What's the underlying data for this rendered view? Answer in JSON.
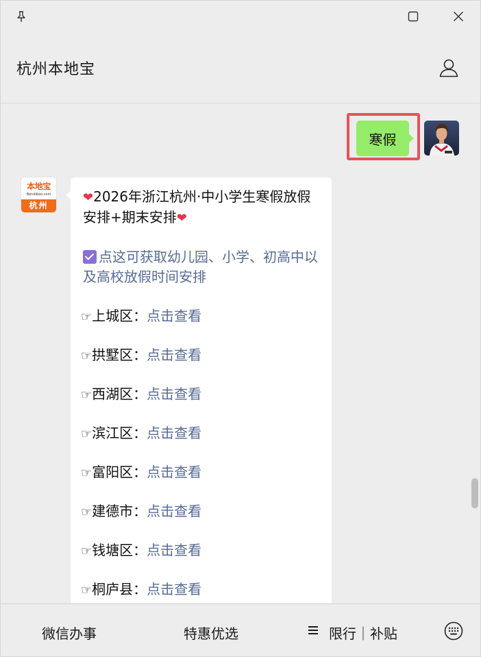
{
  "window": {
    "icons": {
      "pin": "pin-icon",
      "maximize": "maximize-icon",
      "close": "close-icon"
    }
  },
  "header": {
    "title": "杭州本地宝",
    "profile_icon": "person-icon"
  },
  "messages": {
    "sent": {
      "text": "寒假",
      "highlight_color": "#e5535a",
      "bubble_color": "#95ec69"
    },
    "received": {
      "avatar": {
        "logo_text": "本地宝",
        "logo_url": "Bendibao.com",
        "city": "杭州"
      },
      "headline": "2026年浙江杭州·中小学生寒假放假安排+期末安排",
      "promo": "点这可获取幼儿园、小学、初高中以及高校放假时间安排",
      "districts": [
        {
          "name": "上城区：",
          "link": "点击查看"
        },
        {
          "name": "拱墅区：",
          "link": "点击查看"
        },
        {
          "name": "西湖区：",
          "link": "点击查看"
        },
        {
          "name": "滨江区：",
          "link": "点击查看"
        },
        {
          "name": "富阳区：",
          "link": "点击查看"
        },
        {
          "name": "建德市：",
          "link": "点击查看"
        },
        {
          "name": "钱塘区：",
          "link": "点击查看"
        },
        {
          "name": "桐庐县：",
          "link": "点击查看"
        }
      ],
      "link_color": "#576b95"
    }
  },
  "menu": {
    "items": [
      "微信办事",
      "特惠优选",
      "限行｜补贴"
    ],
    "keyboard_icon": "keyboard-icon"
  }
}
